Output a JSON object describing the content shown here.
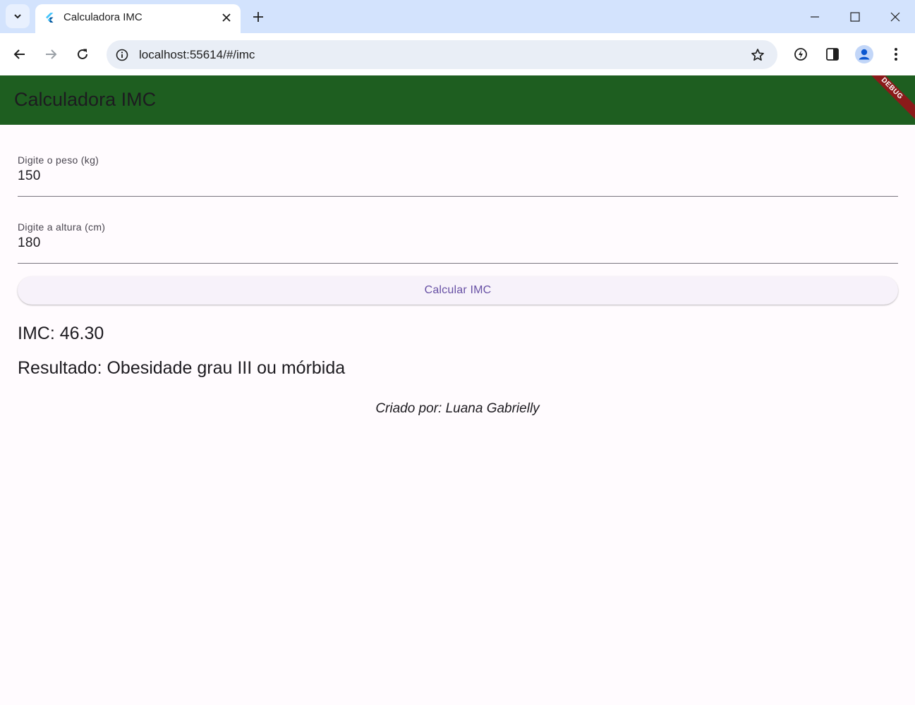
{
  "browser": {
    "tab_title": "Calculadora IMC",
    "url": "localhost:55614/#/imc"
  },
  "app": {
    "title": "Calculadora IMC",
    "debug_label": "DEBUG",
    "appbar_color": "#1e5e20",
    "weight_field": {
      "label": "Digite o peso (kg)",
      "value": "150"
    },
    "height_field": {
      "label": "Digite a altura (cm)",
      "value": "180"
    },
    "calculate_label": "Calcular IMC",
    "imc_text": "IMC: 46.30",
    "result_text": "Resultado: Obesidade grau III ou mórbida",
    "author_text": "Criado por: Luana Gabrielly"
  },
  "icons": [
    "tab-search-icon",
    "flutter-favicon-icon",
    "close-tab-icon",
    "new-tab-icon",
    "minimize-icon",
    "maximize-icon",
    "close-window-icon",
    "back-icon",
    "forward-icon",
    "reload-icon",
    "site-info-icon",
    "bookmark-star-icon",
    "performance-icon",
    "side-panel-icon",
    "profile-icon",
    "menu-icon"
  ]
}
